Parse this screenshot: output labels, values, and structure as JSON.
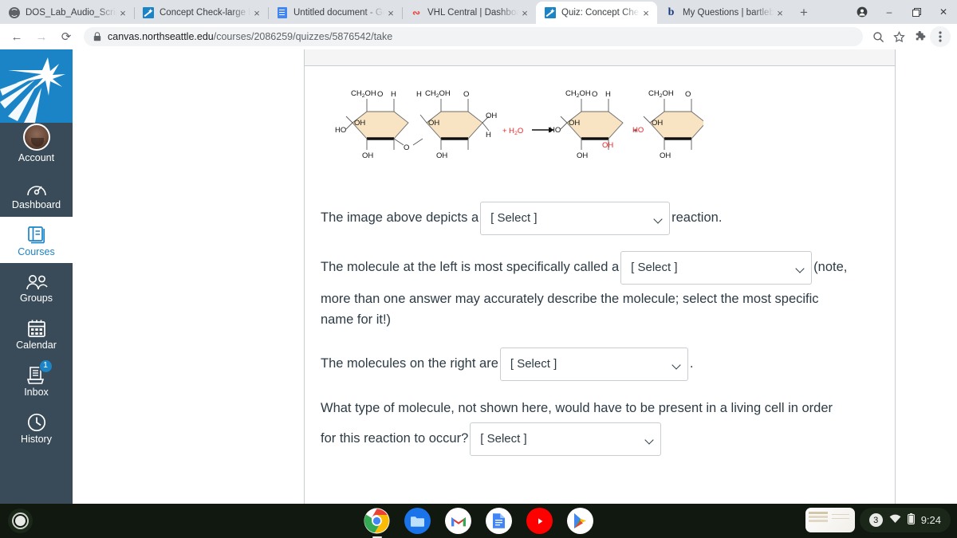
{
  "browser": {
    "tabs": [
      {
        "title": "DOS_Lab_Audio_Script",
        "favicon": "globe-icon",
        "active": false
      },
      {
        "title": "Concept Check-large bi",
        "favicon": "canvas-icon",
        "active": false
      },
      {
        "title": "Untitled document - Go",
        "favicon": "google-docs-icon",
        "active": false
      },
      {
        "title": "VHL Central | Dashboa",
        "favicon": "vhl-icon",
        "active": false
      },
      {
        "title": "Quiz: Concept Check-la",
        "favicon": "canvas-icon",
        "active": true
      },
      {
        "title": "My Questions | bartleby",
        "favicon": "bartleby-icon",
        "active": false
      }
    ],
    "new_tab_label": "+",
    "close_tab_label": "×",
    "window_controls": {
      "minimize": "–",
      "maximize": "❐",
      "close": "✕",
      "profile": "profile-icon"
    },
    "nav": {
      "back": "←",
      "forward": "→",
      "reload": "⟳"
    },
    "omnibox": {
      "lock": "lock-icon",
      "url_host": "canvas.northseattle.edu",
      "url_path": "/courses/2086259/quizzes/5876542/take"
    },
    "toolbar_icons": [
      "search-icon",
      "bookmark-star-icon",
      "extensions-puzzle-icon",
      "chrome-menu-icon"
    ]
  },
  "sidebar": {
    "logo": "north-seattle-college-star-logo",
    "items": [
      {
        "label": "Account",
        "icon": "user-avatar",
        "active": false,
        "badge": null
      },
      {
        "label": "Dashboard",
        "icon": "dashboard-icon",
        "active": false,
        "badge": null
      },
      {
        "label": "Courses",
        "icon": "courses-book-icon",
        "active": true,
        "badge": null
      },
      {
        "label": "Groups",
        "icon": "groups-people-icon",
        "active": false,
        "badge": null
      },
      {
        "label": "Calendar",
        "icon": "calendar-icon",
        "active": false,
        "badge": null
      },
      {
        "label": "Inbox",
        "icon": "inbox-tray-icon",
        "active": false,
        "badge": "1"
      },
      {
        "label": "History",
        "icon": "history-clock-icon",
        "active": false,
        "badge": null
      }
    ]
  },
  "quiz": {
    "figure": {
      "alt": "hydrolysis of a disaccharide into two monosaccharides",
      "left_reactant_labels": [
        "CH₂OH",
        "O",
        "H",
        "H",
        "OH",
        "OH",
        "OH",
        "HO",
        "OH",
        "CH₂OH",
        "O",
        "H",
        "OH"
      ],
      "water_label": "+ H₂O",
      "arrow": "→",
      "plus": "+",
      "product_labels": [
        "CH₂OH",
        "O",
        "H",
        "OH",
        "HO",
        "OH",
        "OH",
        "CH₂OH",
        "O",
        "H",
        "OH",
        "HO",
        "OH"
      ],
      "highlight_color": "#ee2222",
      "ring_fill": "#f8e4c3"
    },
    "questions": [
      {
        "id": "q1",
        "text_before": "The image above depicts a",
        "select_value": "[ Select ]",
        "text_after": "reaction."
      },
      {
        "id": "q2",
        "text_before": "The molecule at the left is most specifically called a",
        "select_value": "[ Select ]",
        "text_after": "(note,",
        "text_continued": "more than one answer may accurately describe the molecule; select the most specific name for it!)"
      },
      {
        "id": "q3",
        "text_before": "The molecules on the right are",
        "select_value": "[ Select ]",
        "text_after": "."
      },
      {
        "id": "q4",
        "text_before": "What type of molecule, not shown here, would have to be present in a living cell in order",
        "text_before_2": "for this reaction to occur?",
        "select_value": "[ Select ]",
        "text_after": ""
      }
    ]
  },
  "shelf": {
    "launcher": "launcher-circle-icon",
    "apps": [
      {
        "name": "chrome-icon",
        "running": true
      },
      {
        "name": "files-icon",
        "running": false
      },
      {
        "name": "gmail-icon",
        "running": false
      },
      {
        "name": "google-docs-icon",
        "running": false
      },
      {
        "name": "youtube-icon",
        "running": false
      },
      {
        "name": "play-store-icon",
        "running": false
      }
    ],
    "status": {
      "notification_count": "3",
      "wifi": "wifi-icon",
      "battery": "battery-icon",
      "time": "9:24"
    }
  },
  "colors": {
    "canvas_blue": "#1b84c7",
    "canvas_nav_bg": "#394B58",
    "chrome_tabstrip": "#dee1e6",
    "text": "#2d3b45",
    "shelf_bg": "#10180f"
  }
}
